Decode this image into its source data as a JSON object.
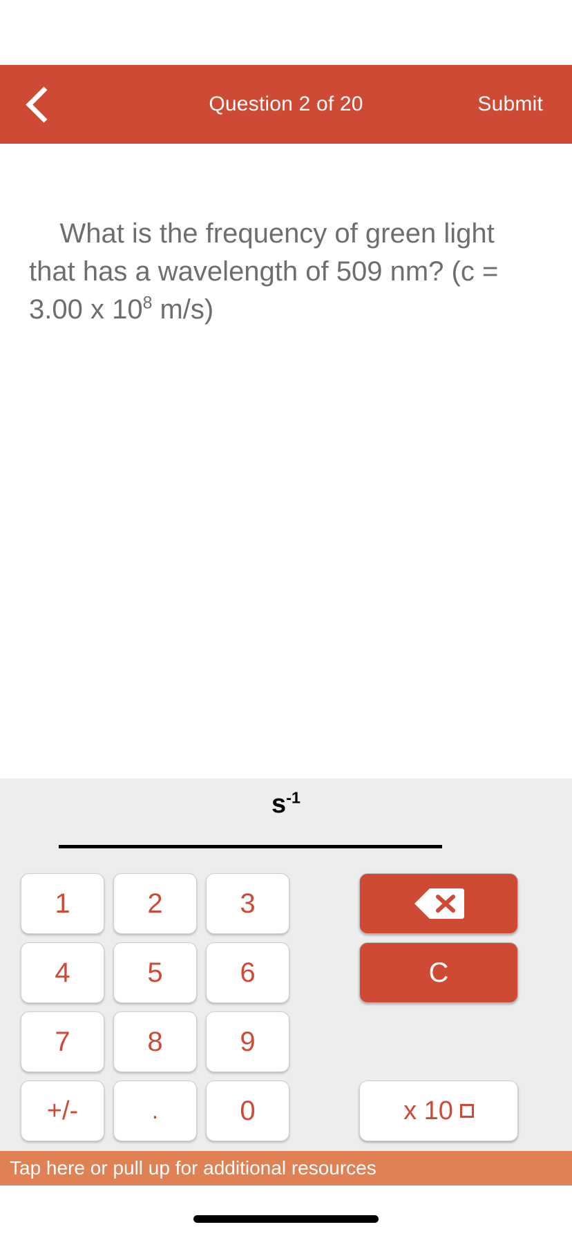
{
  "header": {
    "back_icon": "chevron-left-icon",
    "title": "Question 2 of 20",
    "submit_label": "Submit",
    "background_color": "#CF4A35"
  },
  "question": {
    "text": "What is the frequency of green light that has a wavelength of 509 nm? (c = 3.00 x 10",
    "exponent": "8",
    "text_tail": " m/s)",
    "full_text": "What is the frequency of green light that has a wavelength of 509 nm? (c = 3.00 x 10⁸ m/s)",
    "text_color": "#6E6E6E"
  },
  "answer": {
    "unit": "s",
    "unit_exponent": "-1",
    "value": "",
    "placeholder": ""
  },
  "keypad": {
    "background_color": "#EDEDED",
    "key_text_color": "#CF4A35",
    "rows": [
      {
        "digits": [
          "1",
          "2",
          "3"
        ]
      },
      {
        "digits": [
          "4",
          "5",
          "6"
        ]
      },
      {
        "digits": [
          "7",
          "8",
          "9"
        ]
      },
      {
        "digits": [
          "+/-",
          ".",
          "0"
        ]
      }
    ],
    "actions": {
      "backspace_icon": "backspace-icon",
      "clear_label": "C",
      "exponent_label": "x 10",
      "exponent_placeholder": "□"
    }
  },
  "resources": {
    "label": "Tap here or pull up for additional resources",
    "background_color": "#E08055"
  }
}
